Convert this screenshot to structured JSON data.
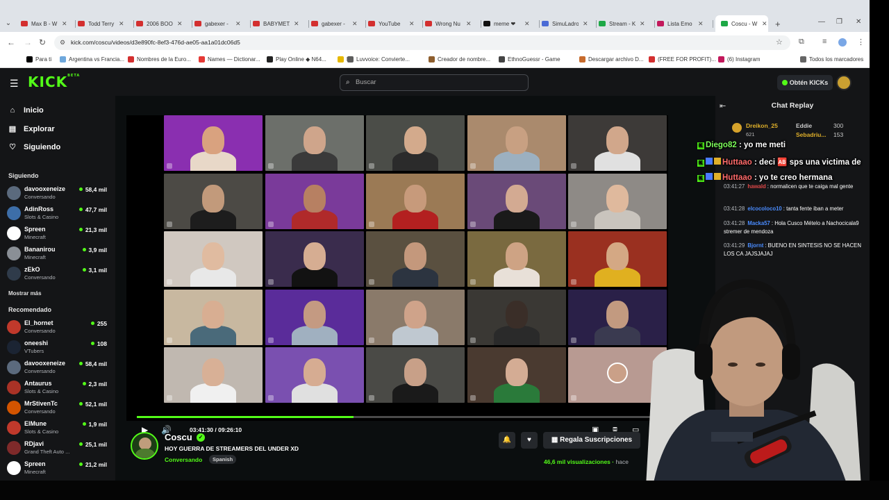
{
  "browser": {
    "tabs": [
      {
        "title": "Max B - W",
        "color": "#d32f2f"
      },
      {
        "title": "Todd Terry",
        "color": "#d32f2f"
      },
      {
        "title": "2006 BOO",
        "color": "#d32f2f"
      },
      {
        "title": "gabexer -",
        "color": "#d32f2f"
      },
      {
        "title": "BABYMETA",
        "color": "#d32f2f"
      },
      {
        "title": "gabexer -",
        "color": "#d32f2f"
      },
      {
        "title": "YouTube",
        "color": "#d32f2f"
      },
      {
        "title": "Wrong Nu",
        "color": "#d32f2f"
      },
      {
        "title": "meme ❤",
        "color": "#111111"
      },
      {
        "title": "SimuLadro",
        "color": "#4a6bd6"
      },
      {
        "title": "Stream - K",
        "color": "#1da846"
      },
      {
        "title": "Lista Emo",
        "color": "#c2185b"
      },
      {
        "title": "Coscu - W",
        "color": "#1da846"
      }
    ],
    "url": "kick.com/coscu/videos/d3e890fc-8ef3-476d-ae05-aa1a01dc06d5",
    "bookmarks": [
      "Para ti",
      "Argentina vs Francia...",
      "Nombres de la Euro...",
      "Names — Dictionar...",
      "Play Online ◆ N64...",
      "b",
      "Luvvoice: Convierte...",
      "Creador de nombre...",
      "EthnoGuessr - Game",
      "Descargar archivo D...",
      "(FREE FOR PROFIT)...",
      "(6) Instagram",
      "Todos los marcadores"
    ]
  },
  "header": {
    "logo": "KICK",
    "logo_beta": "BETA",
    "search_placeholder": "Buscar",
    "get_kicks": "Obtén KICKs"
  },
  "sidebar": {
    "nav": [
      "Inicio",
      "Explorar",
      "Siguiendo"
    ],
    "following_title": "Siguiendo",
    "following": [
      {
        "name": "davooxeneize",
        "category": "Conversando",
        "viewers": "58,4 mil",
        "color": "#5b6a7d"
      },
      {
        "name": "AdinRoss",
        "category": "Slots & Casino",
        "viewers": "47,7 mil",
        "color": "#3d6ea8"
      },
      {
        "name": "Spreen",
        "category": "Minecraft",
        "viewers": "21,3 mil",
        "color": "#ffffff"
      },
      {
        "name": "Bananirou",
        "category": "Minecraft",
        "viewers": "3,9 mil",
        "color": "#8a8f96"
      },
      {
        "name": "zEkO",
        "category": "Conversando",
        "viewers": "3,1 mil",
        "color": "#2f3b4a"
      }
    ],
    "show_more": "Mostrar más",
    "recommended_title": "Recomendado",
    "recommended": [
      {
        "name": "El_hornet",
        "category": "Conversando",
        "viewers": "255",
        "color": "#c0392b"
      },
      {
        "name": "oneeshi",
        "category": "VTubers",
        "viewers": "108",
        "color": "#1b2433"
      },
      {
        "name": "davooxeneize",
        "category": "Conversando",
        "viewers": "58,4 mil",
        "color": "#5b6a7d"
      },
      {
        "name": "Antaurus",
        "category": "Slots & Casino",
        "viewers": "2,3 mil",
        "color": "#a93226"
      },
      {
        "name": "MrStivenTc",
        "category": "Conversando",
        "viewers": "52,1 mil",
        "color": "#d35400"
      },
      {
        "name": "ElMune",
        "category": "Slots & Casino",
        "viewers": "1,9 mil",
        "color": "#c0392b"
      },
      {
        "name": "RDjavi",
        "category": "Grand Theft Auto ...",
        "viewers": "25,1 mil",
        "color": "#7f2a2a"
      },
      {
        "name": "Spreen",
        "category": "Minecraft",
        "viewers": "21,2 mil",
        "color": "#ffffff"
      }
    ]
  },
  "player": {
    "time": "03:41:30 / 09:26:10",
    "progress": 0.4
  },
  "stream": {
    "name": "Coscu",
    "title": "HOY GUERRA DE STREAMERS DEL UNDER XD",
    "category": "Conversando",
    "language": "Spanish",
    "gift_label": "Regala Suscripciones",
    "views": "46,6 mil visualizaciones",
    "views_suffix": "hace"
  },
  "chat": {
    "title": "Chat Replay",
    "gifters": [
      {
        "name": "Dreikon_25",
        "count": "621"
      },
      {
        "name": "Eddie",
        "count": "300"
      },
      {
        "name": "Sebadriu...",
        "count": "153"
      }
    ],
    "messages": [
      {
        "time": "03:41:27",
        "user": "hawald",
        "user_color": "#e04848",
        "text": "normalicen que te caiga mal gente"
      },
      {
        "time": "03:41:28",
        "user": "elcocoloco10",
        "user_color": "#4a8cff",
        "text": "tanta fente iban a meter"
      },
      {
        "time": "03:41:28",
        "user": "Macka57",
        "user_color": "#4a8cff",
        "text": "Hola Cusco Mételo a Nachocicala9 stremer de mendoza"
      },
      {
        "time": "03:41:29",
        "user": "Bjornt",
        "user_color": "#4a8cff",
        "text": "BUENO EN SINTESIS NO SE HACEN LOS CA JAJSJAJAJ"
      }
    ]
  },
  "overlay_chat": [
    {
      "user": "Diego82",
      "text": "yo me meti"
    },
    {
      "user": "Huttaao",
      "text": "deci 🆎 sps una victima de"
    },
    {
      "user": "Huttaao",
      "text": "yo te creo hermana"
    }
  ],
  "accent_color": "#53fc18"
}
